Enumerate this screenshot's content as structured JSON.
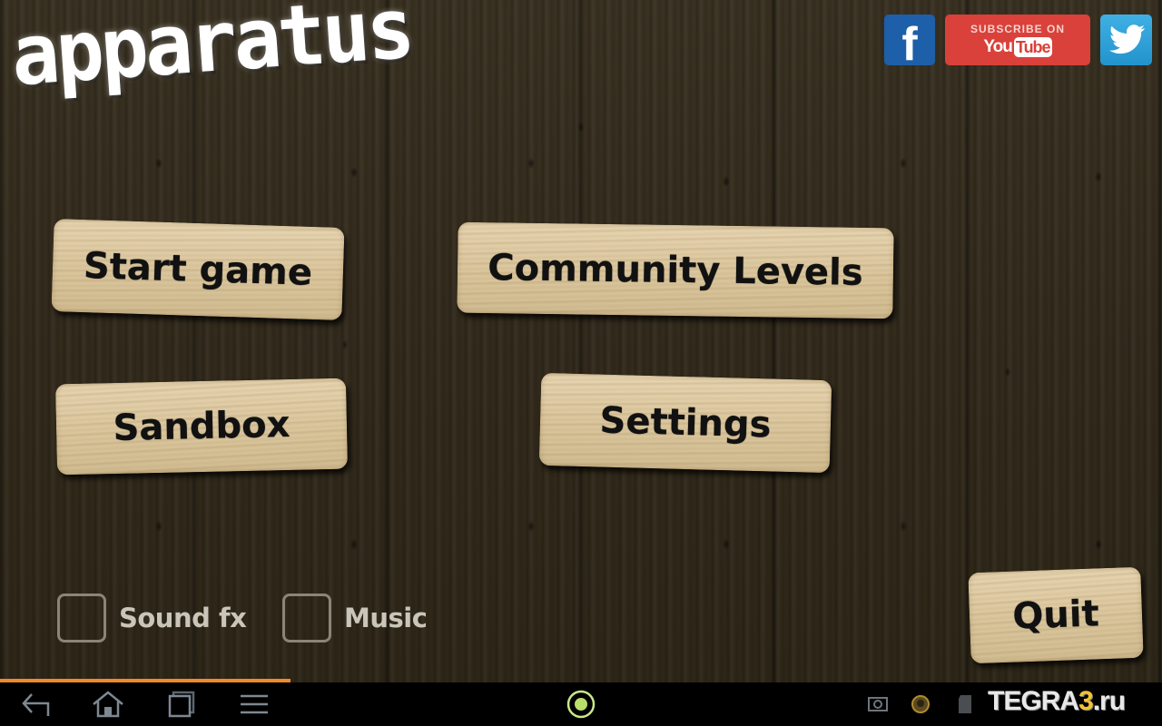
{
  "app": {
    "title": "apparatus"
  },
  "social": {
    "facebook": {
      "glyph": "f",
      "icon": "facebook-icon",
      "color": "#1d5fa8"
    },
    "youtube": {
      "top_text": "SUBSCRIBE ON",
      "you": "You",
      "tube": "Tube",
      "icon": "youtube-icon",
      "color": "#d9413a"
    },
    "twitter": {
      "icon": "twitter-bird-icon",
      "color": "#2ba3db"
    }
  },
  "menu": {
    "start_game": "Start game",
    "community_levels": "Community Levels",
    "sandbox": "Sandbox",
    "settings": "Settings",
    "quit": "Quit"
  },
  "options": {
    "sound_fx": {
      "label": "Sound fx",
      "checked": false
    },
    "music": {
      "label": "Music",
      "checked": false
    }
  },
  "loading": {
    "progress_percent": 25,
    "color": "#f08a28"
  },
  "navbar": {
    "buttons": [
      "back-icon",
      "home-icon",
      "recent-apps-icon",
      "menu-icon"
    ],
    "center_icon": "launcher-dot-icon",
    "status_icons": [
      "screenshot-icon",
      "app-notification-icon",
      "sd-card-icon",
      "battery-icon"
    ]
  },
  "watermark": {
    "prefix": "TEGRA",
    "number": "3",
    "suffix": ".ru"
  }
}
